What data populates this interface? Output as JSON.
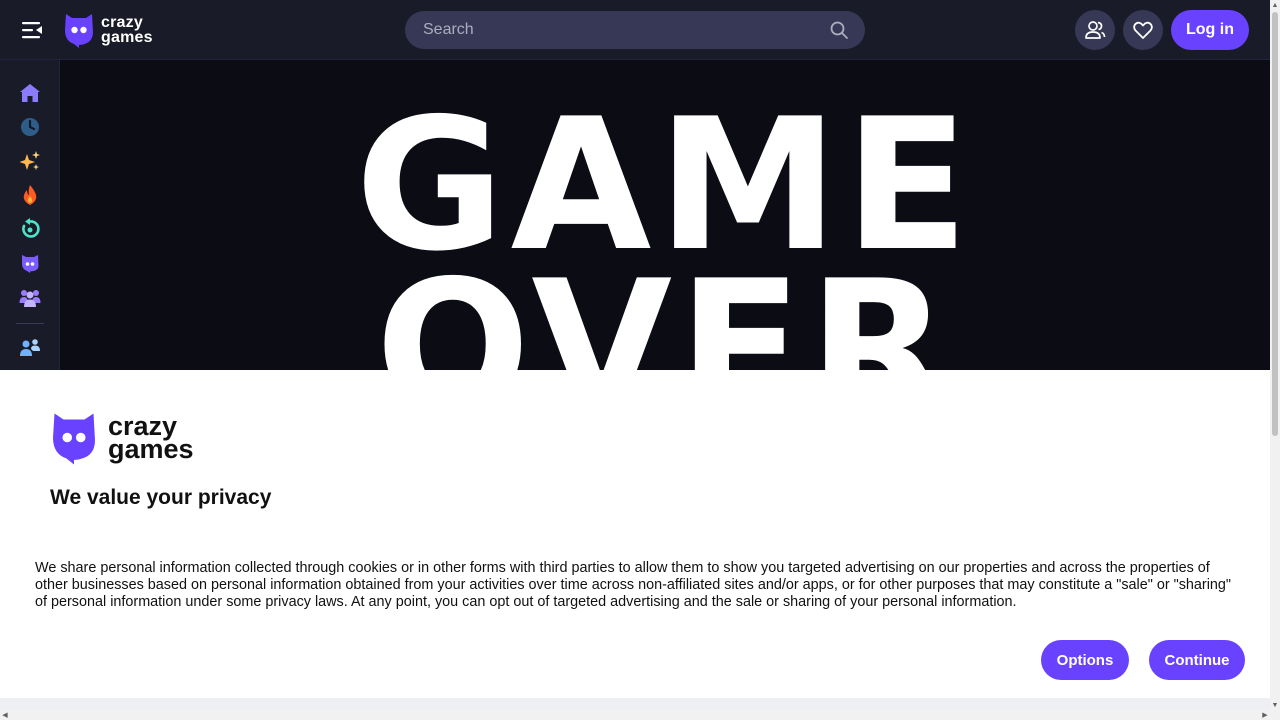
{
  "header": {
    "logo": {
      "line1": "crazy",
      "line2": "games"
    },
    "search": {
      "placeholder": "Search"
    },
    "login_label": "Log in"
  },
  "sidebar": {
    "items": [
      {
        "name": "home",
        "icon": "home-icon"
      },
      {
        "name": "recent",
        "icon": "clock-icon"
      },
      {
        "name": "new",
        "icon": "sparkles-icon"
      },
      {
        "name": "trending",
        "icon": "fire-icon"
      },
      {
        "name": "updated",
        "icon": "refresh-icon"
      },
      {
        "name": "originals",
        "icon": "crazygames-icon"
      },
      {
        "name": "multiplayer",
        "icon": "group-icon"
      },
      {
        "name": "friends",
        "icon": "friends-icon"
      }
    ]
  },
  "game": {
    "line1": "GAME",
    "line2": "OVER"
  },
  "consent": {
    "logo": {
      "line1": "crazy",
      "line2": "games"
    },
    "title": "We value your privacy",
    "body": "We share personal information collected through cookies or in other forms with third parties to allow them to show you targeted advertising on our properties and across the properties of other businesses based on personal information obtained from your activities over time across non-affiliated sites and/or apps, or for other purposes that may constitute a \"sale\" or \"sharing\" of personal information under some privacy laws. At any point, you can opt out of targeted advertising and the sale or sharing of your personal information.",
    "options_label": "Options",
    "continue_label": "Continue"
  },
  "colors": {
    "brand": "#6842ff",
    "header_bg": "#1a1b28",
    "search_bg": "#373855",
    "game_bg": "#0c0d14"
  }
}
